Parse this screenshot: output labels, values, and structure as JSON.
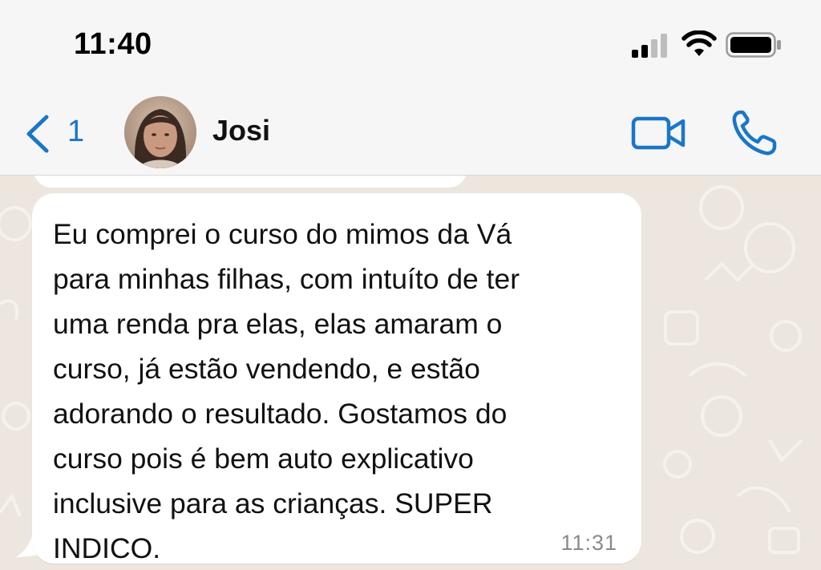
{
  "status_bar": {
    "time": "11:40",
    "signal_icon": "cellular-signal-icon",
    "wifi_icon": "wifi-icon",
    "battery_icon": "battery-icon"
  },
  "header": {
    "back_count": "1",
    "contact_name": "Josi",
    "video_icon": "video-camera-icon",
    "call_icon": "phone-icon"
  },
  "message": {
    "text": "Eu comprei o curso do mimos da Vá\npara minhas filhas, com intuíto de ter\numa renda pra elas, elas amaram o\ncurso, já estão vendendo, e estão\nadorando o resultado. Gostamos do\ncurso pois é bem auto explicativo\ninclusive para as crianças. SUPER\nINDICO.",
    "time": "11:31"
  },
  "colors": {
    "accent": "#1a76c9",
    "chat_background": "#ece6de",
    "bubble": "#ffffff"
  }
}
